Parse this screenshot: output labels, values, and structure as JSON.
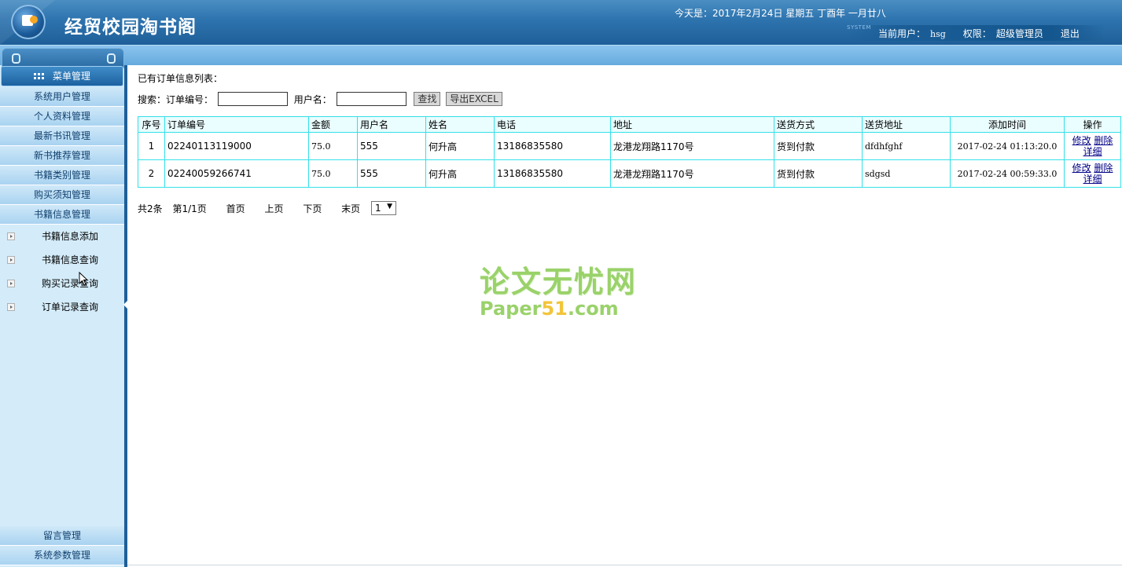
{
  "header": {
    "app_title": "经贸校园淘书阁",
    "date_text": "今天是：2017年2月24日 星期五 丁酉年 一月廿八",
    "system_mark": "SYSTEM",
    "current_user_label": "当前用户：",
    "current_user": "hsg",
    "role_label": "权限：",
    "role": "超级管理员",
    "logout_label": "退出",
    "colors": {
      "primary": "#2d73ae",
      "light": "#8cc4ee"
    }
  },
  "sidebar": {
    "menu_header": "菜单管理",
    "menu_items": [
      "系统用户管理",
      "个人资料管理",
      "最新书讯管理",
      "新书推荐管理",
      "书籍类别管理",
      "购买须知管理",
      "书籍信息管理"
    ],
    "sub_items": [
      "书籍信息添加",
      "书籍信息查询",
      "购买记录查询",
      "订单记录查询"
    ],
    "bottom_items": [
      "留言管理",
      "系统参数管理"
    ]
  },
  "main": {
    "list_title": "已有订单信息列表：",
    "search": {
      "label": "搜索：",
      "order_no_label": "订单编号：",
      "order_no_value": "",
      "username_label": "用户名：",
      "username_value": "",
      "search_button": "查找",
      "export_button": "导出EXCEL"
    },
    "table": {
      "headers": [
        "序号",
        "订单编号",
        "金额",
        "用户名",
        "姓名",
        "电话",
        "地址",
        "送货方式",
        "送货地址",
        "添加时间",
        "操作"
      ],
      "rows": [
        [
          "1",
          "02240113119000",
          "75.0",
          "555",
          "何升高",
          "13186835580",
          "龙港龙翔路1170号",
          "货到付款",
          "dfdhfghf",
          "2017-02-24 01:13:20.0"
        ],
        [
          "2",
          "02240059266741",
          "75.0",
          "555",
          "何升高",
          "13186835580",
          "龙港龙翔路1170号",
          "货到付款",
          "sdgsd",
          "2017-02-24 00:59:33.0"
        ]
      ],
      "actions": {
        "edit": "修改",
        "delete": "删除",
        "detail": "详细"
      }
    },
    "pager": {
      "total": "共2条",
      "page_info": "第1/1页",
      "first": "首页",
      "prev": "上页",
      "next": "下页",
      "last": "末页",
      "selected_page": "1"
    },
    "watermark": {
      "cn": "论文无忧网",
      "en_a": "Paper",
      "en_b": "51",
      "en_c": ".com"
    }
  }
}
